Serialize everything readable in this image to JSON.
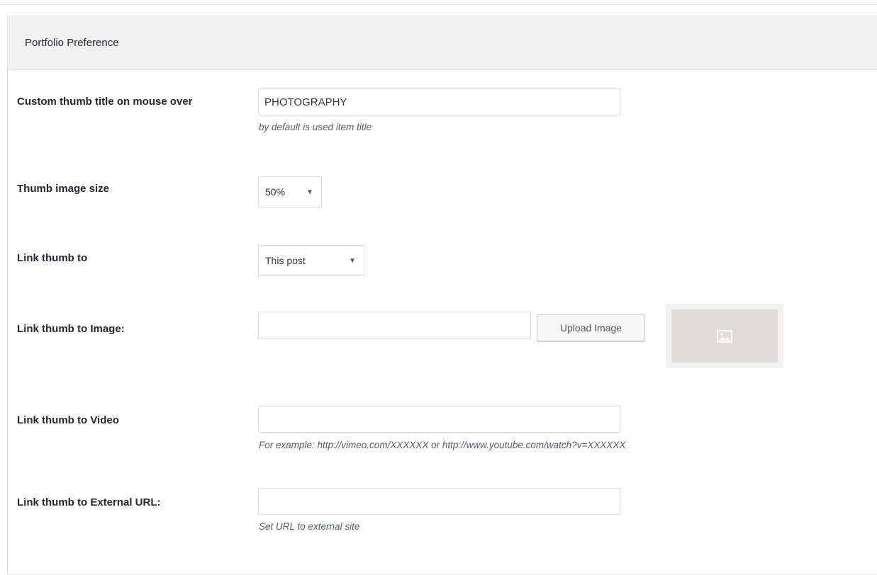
{
  "panel": {
    "title": "Portfolio Preference"
  },
  "fields": {
    "custom_thumb_title": {
      "label": "Custom thumb title on mouse over",
      "value": "PHOTOGRAPHY",
      "help": "by default is used item title"
    },
    "thumb_image_size": {
      "label": "Thumb image size",
      "selected": "50%"
    },
    "link_thumb_to": {
      "label": "Link thumb to",
      "selected": "This post"
    },
    "link_thumb_to_image": {
      "label": "Link thumb to Image:",
      "value": "",
      "upload_label": "Upload Image",
      "preview_icon": "image-icon"
    },
    "link_thumb_to_video": {
      "label": "Link thumb to Video",
      "value": "",
      "help": "For example: http://vimeo.com/XXXXXX or http://www.youtube.com/watch?v=XXXXXX"
    },
    "link_thumb_to_external_url": {
      "label": "Link thumb to External URL:",
      "value": "",
      "help": "Set URL to external site"
    }
  },
  "colors": {
    "header_bg": "#f1f1f1",
    "border": "#dddddd",
    "placeholder_bg": "#e0ddd7"
  }
}
